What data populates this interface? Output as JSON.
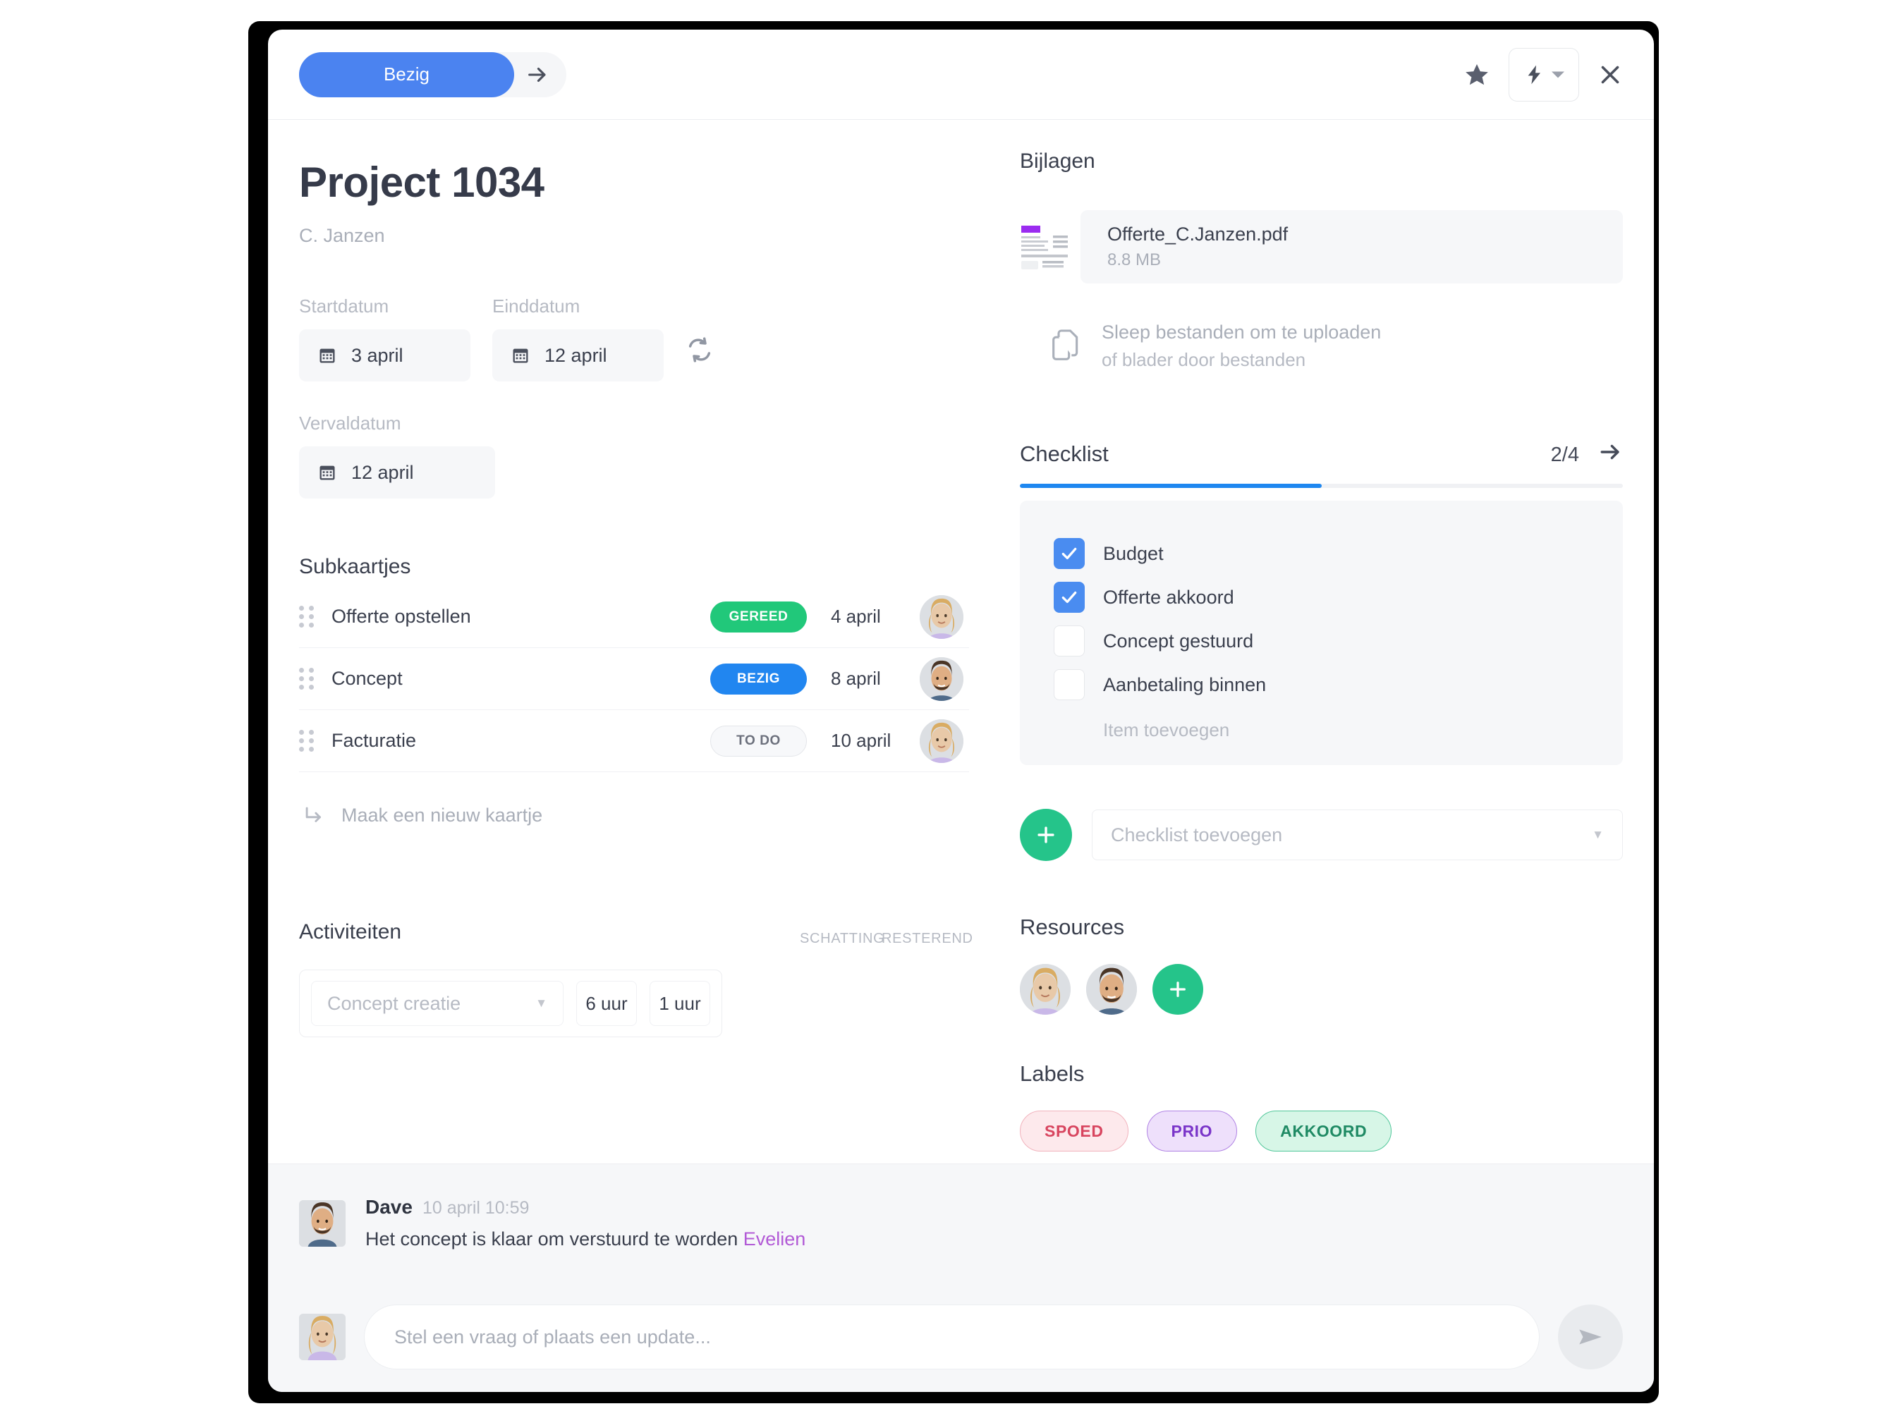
{
  "topbar": {
    "status_label": "Bezig",
    "next_icon": "arrow-right-icon",
    "star_icon": "star-icon",
    "bolt_icon": "lightning-bolt-icon",
    "caret_icon": "chevron-down-icon",
    "close_icon": "close-icon"
  },
  "project": {
    "title": "Project 1034",
    "client": "C. Janzen"
  },
  "dates": {
    "start_label": "Startdatum",
    "start_value": "3 april",
    "end_label": "Einddatum",
    "end_value": "12 april",
    "due_label": "Vervaldatum",
    "due_value": "12 april",
    "sync_icon": "sync-icon",
    "calendar_icon": "calendar-icon"
  },
  "subcards": {
    "title": "Subkaartjes",
    "rows": [
      {
        "name": "Offerte opstellen",
        "status": "GEREED",
        "status_kind": "gereed",
        "date": "4 april",
        "avatar": "woman"
      },
      {
        "name": "Concept",
        "status": "BEZIG",
        "status_kind": "bezig",
        "date": "8 april",
        "avatar": "man"
      },
      {
        "name": "Facturatie",
        "status": "TO DO",
        "status_kind": "todo",
        "date": "10 april",
        "avatar": "woman"
      }
    ],
    "new_card_label": "Maak een nieuw kaartje",
    "new_card_icon": "arrow-turn-down-right-icon"
  },
  "activities": {
    "title": "Activiteiten",
    "col_estimate": "SCHATTING",
    "col_remaining": "RESTEREND",
    "row": {
      "name_placeholder": "Concept creatie",
      "estimate": "6 uur",
      "remaining": "1 uur"
    }
  },
  "attachments": {
    "title": "Bijlagen",
    "file_name": "Offerte_C.Janzen.pdf",
    "file_size": "8.8 MB",
    "file_icon": "pdf-document-icon",
    "drop_line1": "Sleep bestanden om te uploaden",
    "drop_line2": "of blader door bestanden",
    "drop_icon": "copy-files-icon"
  },
  "checklist": {
    "title": "Checklist",
    "count": "2/4",
    "arrow_icon": "arrow-right-icon",
    "progress_percent": 50,
    "items": [
      {
        "label": "Budget",
        "checked": true
      },
      {
        "label": "Offerte akkoord",
        "checked": true
      },
      {
        "label": "Concept gestuurd",
        "checked": false
      },
      {
        "label": "Aanbetaling binnen",
        "checked": false
      }
    ],
    "add_item_label": "Item toevoegen",
    "add_button_icon": "plus-icon",
    "add_select_placeholder": "Checklist toevoegen"
  },
  "resources": {
    "title": "Resources",
    "members": [
      {
        "avatar": "woman"
      },
      {
        "avatar": "man"
      }
    ],
    "add_icon": "plus-icon"
  },
  "labels": {
    "title": "Labels",
    "chips": [
      {
        "text": "SPOED",
        "bg": "#fde9ec",
        "border": "#f1b3bd",
        "color": "#d8455f"
      },
      {
        "text": "PRIO",
        "bg": "#eee0fb",
        "border": "#b083e4",
        "color": "#7a35c9"
      },
      {
        "text": "AKKOORD",
        "bg": "#d7f6e7",
        "border": "#51c79a",
        "color": "#1f8a64"
      }
    ]
  },
  "comment": {
    "author": "Dave",
    "time": "10 april 10:59",
    "text": "Het concept is klaar om verstuurd te worden ",
    "mention": "Evelien",
    "avatar": "man"
  },
  "composer": {
    "placeholder": "Stel een vraag of plaats een update...",
    "send_icon": "send-icon",
    "avatar": "woman"
  },
  "colors": {
    "accent_blue": "#4b83f0",
    "status_blue": "#2186f0",
    "green": "#21c87a",
    "teal_fab": "#25c48a",
    "progress_blue": "#1e87f0",
    "mention_purple": "#b25ad6"
  }
}
